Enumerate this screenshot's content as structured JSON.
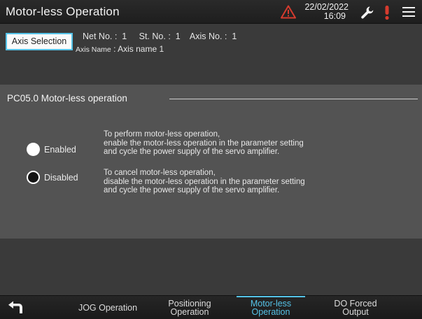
{
  "header": {
    "title": "Motor-less Operation",
    "date": "22/02/2022",
    "time": "16:09",
    "icons": [
      "warning-triangle-icon",
      "wrench-icon",
      "alert-exclamation-icon",
      "menu-icon"
    ]
  },
  "axis": {
    "select_button": "Axis Selection",
    "net_no_label": "Net No.",
    "net_no": "1",
    "st_no_label": "St. No.",
    "st_no": "1",
    "axis_no_label": "Axis No.",
    "axis_no": "1",
    "axis_name_label": "Axis Name",
    "axis_name": "Axis name 1"
  },
  "panel": {
    "header": "PC05.0 Motor-less operation",
    "options": [
      {
        "label": "Enabled",
        "selected": true,
        "desc": [
          "To perform motor-less operation,",
          "enable the motor-less operation in the parameter setting",
          "and cycle the power supply of the servo amplifier."
        ]
      },
      {
        "label": "Disabled",
        "selected": false,
        "desc": [
          "To cancel motor-less operation,",
          "disable the motor-less operation in the parameter setting",
          "and cycle the power supply of the servo amplifier."
        ]
      }
    ]
  },
  "tabs": {
    "back_icon": "back-arrow-icon",
    "jog": "JOG Operation",
    "positioning": [
      "Positioning",
      "Operation"
    ],
    "motorless": [
      "Motor-less",
      "Operation"
    ],
    "do_forced": [
      "DO Forced",
      "Output"
    ],
    "active": "motorless"
  },
  "colors": {
    "accent": "#55c3e8",
    "warning": "#d63b2e",
    "panel_bg": "#535353",
    "page_bg": "#3a3a3a"
  }
}
